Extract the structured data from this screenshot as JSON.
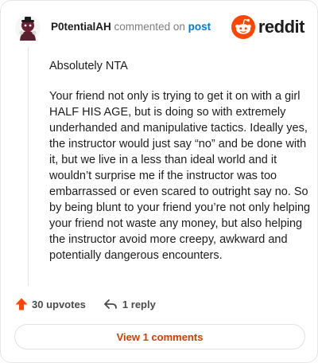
{
  "comment": {
    "username": "P0tentialAH",
    "action_text": "commented on",
    "post_link": "post",
    "paragraphs": [
      "Absolutely NTA",
      "Your friend not only is trying to get it on with a girl HALF HIS AGE, but is doing so with extremely underhanded and manipulative tactics. Ideally yes, the instructor would just say “no” and be done with it, but we live in a less than ideal world and it wouldn’t surprise me if the instructor was too embarrassed or even scared to outright say no. So by being blunt to your friend you’re not only helping your friend not waste any money, but also helping the instructor avoid more creepy, awkward and potentially dangerous encounters."
    ]
  },
  "brand": {
    "name": "reddit"
  },
  "actions": {
    "upvotes": "30 upvotes",
    "reply": "1 reply"
  },
  "view_comments": "View 1 comments",
  "colors": {
    "upvote": "#ff4500",
    "brand_orange": "#ff4500",
    "link_blue": "#0079d3",
    "view_button_text": "#d93a00"
  },
  "icons": [
    "avatar-icon",
    "reddit-snoo-icon",
    "upvote-arrow-icon",
    "reply-arrow-icon"
  ]
}
